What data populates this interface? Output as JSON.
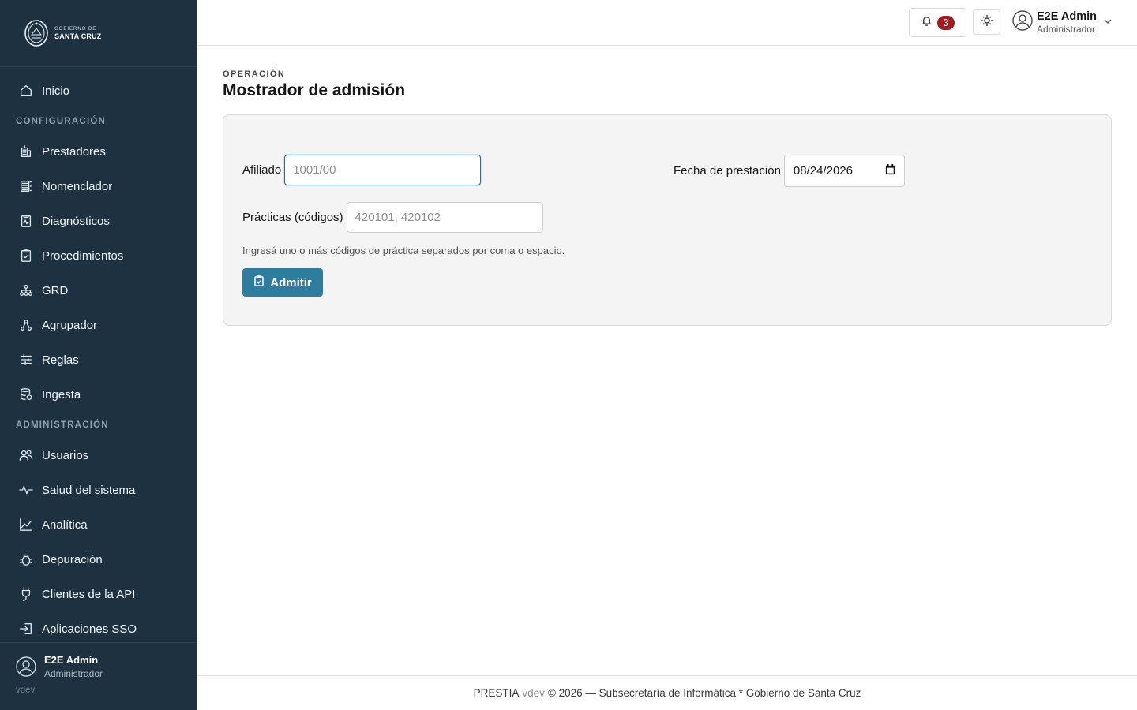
{
  "sidebar": {
    "brand": {
      "line1": "GOBIERNO DE",
      "line2": "SANTA CRUZ"
    },
    "home": {
      "label": "Inicio",
      "icon": "home-icon"
    },
    "sections": [
      {
        "title": "CONFIGURACIÓN",
        "items": [
          {
            "label": "Prestadores",
            "icon": "building-icon"
          },
          {
            "label": "Nomenclador",
            "icon": "list-icon"
          },
          {
            "label": "Diagnósticos",
            "icon": "diagnostic-icon"
          },
          {
            "label": "Procedimientos",
            "icon": "clipboard-check-icon"
          },
          {
            "label": "GRD",
            "icon": "hierarchy-icon"
          },
          {
            "label": "Agrupador",
            "icon": "tree-icon"
          },
          {
            "label": "Reglas",
            "icon": "sliders-icon"
          },
          {
            "label": "Ingesta",
            "icon": "database-icon"
          }
        ]
      },
      {
        "title": "ADMINISTRACIÓN",
        "items": [
          {
            "label": "Usuarios",
            "icon": "users-icon"
          },
          {
            "label": "Salud del sistema",
            "icon": "activity-icon"
          },
          {
            "label": "Analítica",
            "icon": "chart-line-icon"
          },
          {
            "label": "Depuración",
            "icon": "bug-icon"
          },
          {
            "label": "Clientes de la API",
            "icon": "plug-icon"
          },
          {
            "label": "Aplicaciones SSO",
            "icon": "login-icon"
          }
        ]
      }
    ],
    "user": {
      "name": "E2E Admin",
      "role": "Administrador",
      "version": "vdev"
    }
  },
  "topbar": {
    "notifications_count": "3",
    "user": {
      "name": "E2E Admin",
      "role": "Administrador"
    }
  },
  "page": {
    "eyebrow": "OPERACIÓN",
    "title": "Mostrador de admisión"
  },
  "form": {
    "afiliado": {
      "label": "Afiliado",
      "value": "",
      "placeholder": "1001/00"
    },
    "fecha": {
      "label": "Fecha de prestación",
      "value": "08/24/2026"
    },
    "practicas": {
      "label": "Prácticas (códigos)",
      "value": "",
      "placeholder": "420101, 420102"
    },
    "helper": "Ingresá uno o más códigos de práctica separados por coma o espacio.",
    "submit_label": "Admitir"
  },
  "footer": {
    "app": "PRESTIA",
    "version": "vdev",
    "text": "© 2026 — Subsecretaría de Informática * Gobierno de Santa Cruz"
  },
  "colors": {
    "sidebar_bg": "#1d3140",
    "primary": "#2f7d9e",
    "badge": "#a2191f"
  }
}
